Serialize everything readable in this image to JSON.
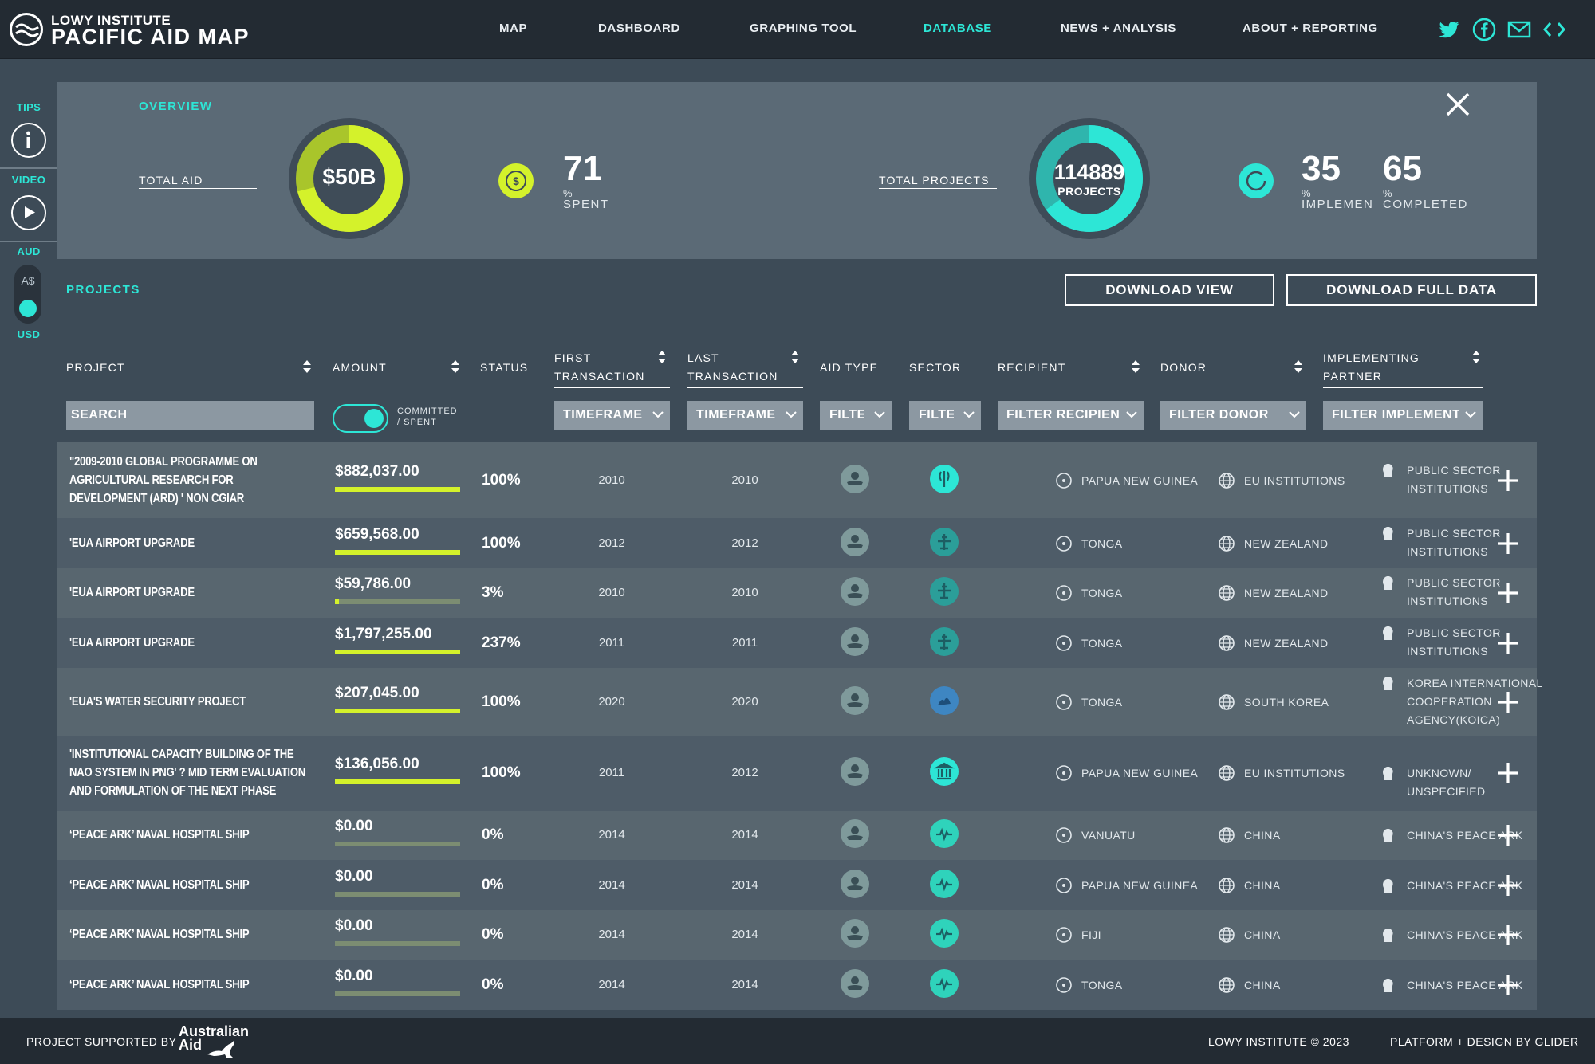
{
  "brand": {
    "line1": "LOWY INSTITUTE",
    "line2": "PACIFIC AID MAP"
  },
  "nav": [
    {
      "label": "MAP",
      "active": false
    },
    {
      "label": "DASHBOARD",
      "active": false
    },
    {
      "label": "GRAPHING TOOL",
      "active": false
    },
    {
      "label": "DATABASE",
      "active": true
    },
    {
      "label": "NEWS + ANALYSIS",
      "active": false
    },
    {
      "label": "ABOUT + REPORTING",
      "active": false
    }
  ],
  "social": [
    "twitter-icon",
    "facebook-icon",
    "email-icon",
    "embed-code-icon"
  ],
  "rail": {
    "tips": "TIPS",
    "video": "VIDEO",
    "aud": "AUD",
    "aud_symbol": "A$",
    "usd": "USD"
  },
  "overview": {
    "title": "OVERVIEW",
    "total_aid_label": "TOTAL AID",
    "total_aid_value": "$50B",
    "spent_number": "71",
    "spent_pct": "%",
    "spent_word": "SPENT",
    "spent_fraction": 0.71,
    "total_projects_label": "TOTAL PROJECTS",
    "total_projects_value": "114889",
    "total_projects_unit": "PROJECTS",
    "implementing_number": "35",
    "implementing_pct": "%",
    "implementing_word": "IMPLEMENTING",
    "completed_number": "65",
    "completed_pct": "%",
    "completed_word": "COMPLETED",
    "completed_fraction": 0.65
  },
  "projects": {
    "title": "PROJECTS",
    "download_view": "DOWNLOAD VIEW",
    "download_full": "DOWNLOAD FULL DATA"
  },
  "columns": {
    "project": "PROJECT",
    "amount": "AMOUNT",
    "status": "STATUS",
    "first_transaction": "FIRST TRANSACTION",
    "last_transaction": "LAST TRANSACTION",
    "aid_type": "AID TYPE",
    "sector": "SECTOR",
    "recipient": "RECIPIENT",
    "donor": "DONOR",
    "implementing_partner": "IMPLEMENTING PARTNER"
  },
  "filters": {
    "search_placeholder": "SEARCH",
    "toggle_label_1": "COMMITTED",
    "toggle_label_2": "/ SPENT",
    "timeframe_first": "TIMEFRAME",
    "timeframe_last": "TIMEFRAME",
    "aid_type": "FILTER",
    "sector": "FILTER",
    "recipient": "FILTER RECIPIENT",
    "donor": "FILTER DONOR",
    "implementing": "FILTER IMPLEMENTING"
  },
  "colors": {
    "accent": "#2de6d6",
    "lime": "#d4f22b",
    "header": "#232b33",
    "panel": "#5b6a76"
  },
  "rows": [
    {
      "project": "\"2009-2010 GLOBAL PROGRAMME ON AGRICULTURAL RESEARCH FOR DEVELOPMENT (ARD) ' NON CGIAR",
      "amount": "$882,037.00",
      "status": "100%",
      "progress": 1.0,
      "first": "2010",
      "last": "2010",
      "sector_icon": "agriculture-icon",
      "recipient": "PAPUA NEW GUINEA",
      "donor": "EU INSTITUTIONS",
      "partner": "PUBLIC SECTOR INSTITUTIONS"
    },
    {
      "project": "'EUA AIRPORT UPGRADE",
      "amount": "$659,568.00",
      "status": "100%",
      "progress": 1.0,
      "first": "2012",
      "last": "2012",
      "sector_icon": "airport-icon",
      "recipient": "TONGA",
      "donor": "NEW ZEALAND",
      "partner": "PUBLIC SECTOR INSTITUTIONS"
    },
    {
      "project": "'EUA AIRPORT UPGRADE",
      "amount": "$59,786.00",
      "status": "3%",
      "progress": 0.03,
      "first": "2010",
      "last": "2010",
      "sector_icon": "airport-icon",
      "recipient": "TONGA",
      "donor": "NEW ZEALAND",
      "partner": "PUBLIC SECTOR INSTITUTIONS"
    },
    {
      "project": "'EUA AIRPORT UPGRADE",
      "amount": "$1,797,255.00",
      "status": "237%",
      "progress": 1.0,
      "first": "2011",
      "last": "2011",
      "sector_icon": "airport-icon",
      "recipient": "TONGA",
      "donor": "NEW ZEALAND",
      "partner": "PUBLIC SECTOR INSTITUTIONS"
    },
    {
      "project": "'EUA'S WATER SECURITY PROJECT",
      "amount": "$207,045.00",
      "status": "100%",
      "progress": 1.0,
      "first": "2020",
      "last": "2020",
      "sector_icon": "water-icon",
      "recipient": "TONGA",
      "donor": "SOUTH KOREA",
      "partner": "KOREA INTERNATIONAL COOPERATION AGENCY(KOICA)"
    },
    {
      "project": "'INSTITUTIONAL CAPACITY BUILDING OF THE NAO SYSTEM IN PNG' ? MID TERM EVALUATION AND FORMULATION OF THE NEXT PHASE",
      "amount": "$136,056.00",
      "status": "100%",
      "progress": 1.0,
      "first": "2011",
      "last": "2012",
      "sector_icon": "government-icon",
      "recipient": "PAPUA NEW GUINEA",
      "donor": "EU INSTITUTIONS",
      "partner": "UNKNOWN/ UNSPECIFIED"
    },
    {
      "project": "‘PEACE ARK’ NAVAL HOSPITAL SHIP",
      "amount": "$0.00",
      "status": "0%",
      "progress": 0.0,
      "first": "2014",
      "last": "2014",
      "sector_icon": "health-icon",
      "recipient": "VANUATU",
      "donor": "CHINA",
      "partner": "CHINA'S PEACE ARK"
    },
    {
      "project": "‘PEACE ARK’ NAVAL HOSPITAL SHIP",
      "amount": "$0.00",
      "status": "0%",
      "progress": 0.0,
      "first": "2014",
      "last": "2014",
      "sector_icon": "health-icon",
      "recipient": "PAPUA NEW GUINEA",
      "donor": "CHINA",
      "partner": "CHINA'S PEACE ARK"
    },
    {
      "project": "‘PEACE ARK’ NAVAL HOSPITAL SHIP",
      "amount": "$0.00",
      "status": "0%",
      "progress": 0.0,
      "first": "2014",
      "last": "2014",
      "sector_icon": "health-icon",
      "recipient": "FIJI",
      "donor": "CHINA",
      "partner": "CHINA'S PEACE ARK"
    },
    {
      "project": "‘PEACE ARK’ NAVAL HOSPITAL SHIP",
      "amount": "$0.00",
      "status": "0%",
      "progress": 0.0,
      "first": "2014",
      "last": "2014",
      "sector_icon": "health-icon",
      "recipient": "TONGA",
      "donor": "CHINA",
      "partner": "CHINA'S PEACE ARK"
    }
  ],
  "footer": {
    "supported_by": "PROJECT SUPPORTED BY",
    "aus_aid_1": "Australian",
    "aus_aid_2": "Aid",
    "copyright": "LOWY INSTITUTE © 2023",
    "platform": "PLATFORM + DESIGN BY GLIDER"
  }
}
